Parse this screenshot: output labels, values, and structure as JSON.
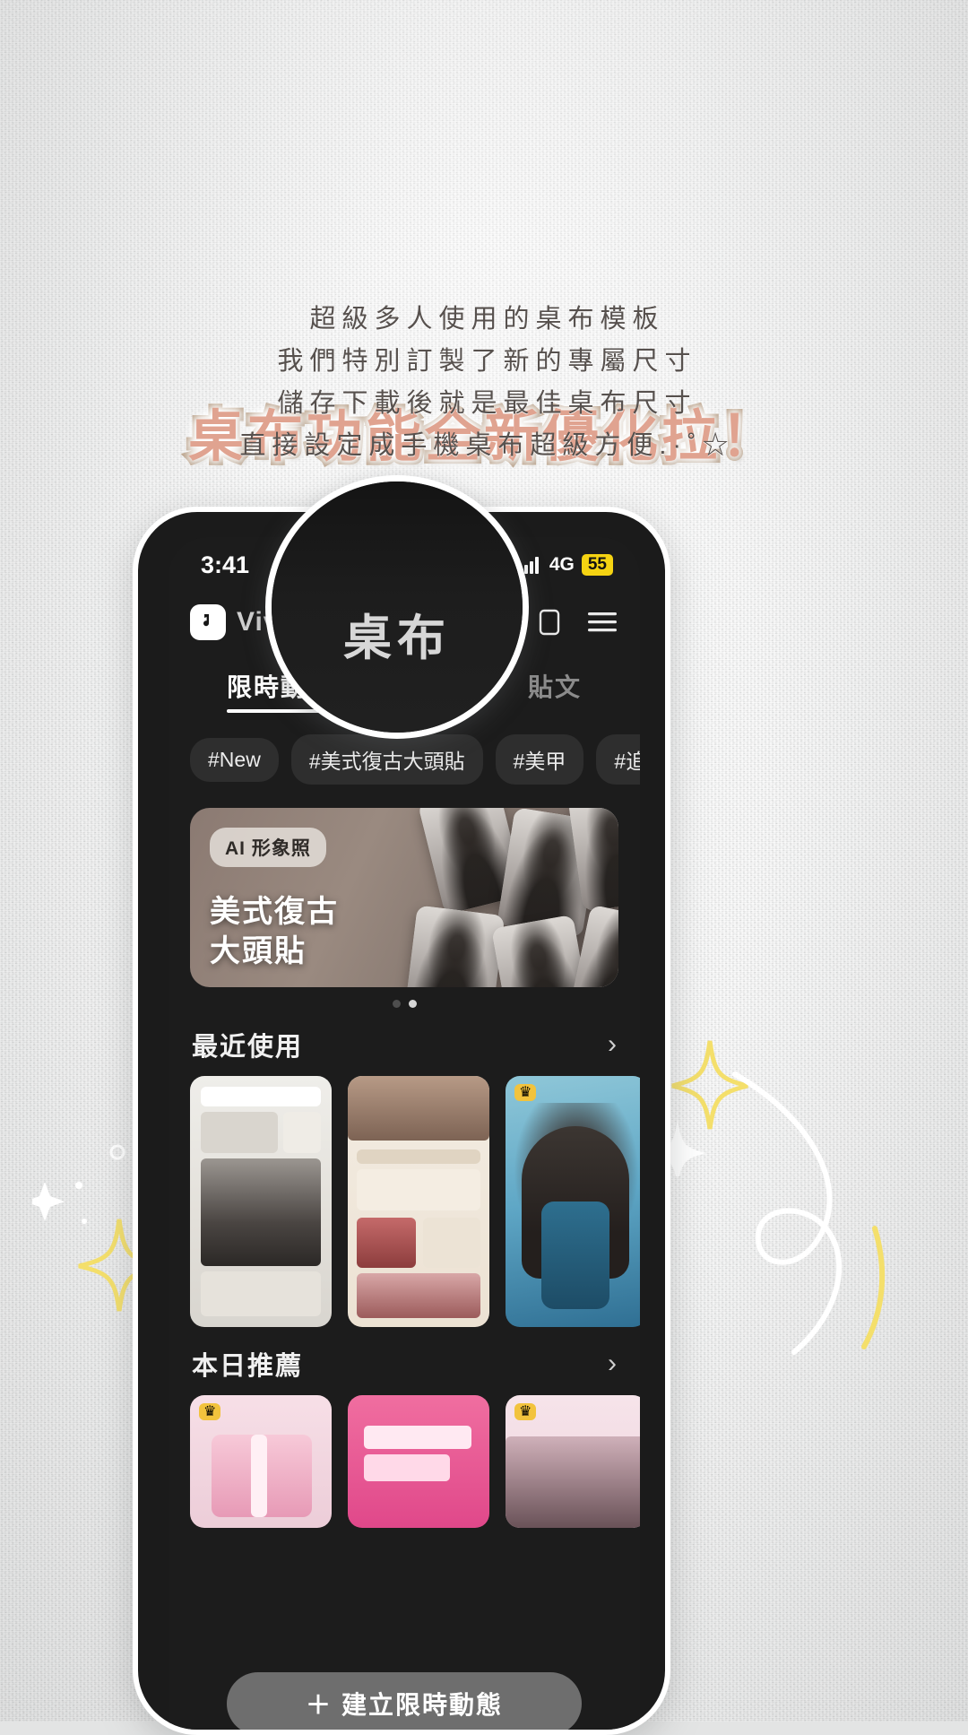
{
  "page": {
    "headline": "桌布功能全新優化拉！",
    "subtitle_lines": [
      "超級多人使用的桌布模板",
      "我們特別訂製了新的專屬尺寸",
      "儲存下載後就是最佳桌布尺寸",
      "直接設定成手機桌布超級方便.·˚☆"
    ],
    "headline_fill_color": "#e2a592",
    "headline_stroke_color": "#b9a189",
    "background_color": "#e5e6e6"
  },
  "magnifier": {
    "label": "桌布"
  },
  "phone": {
    "status_bar": {
      "time": "3:41",
      "network": "4G",
      "battery": "55",
      "signal_icon": "signal-bars-icon",
      "battery_color": "#f5d312"
    },
    "header": {
      "logo_icon": "app-logo-icon",
      "brand": "Vivi",
      "icons": [
        "grid-icon",
        "tablet-icon",
        "hamburger-menu-icon"
      ]
    },
    "tabs": [
      {
        "label": "限時動態",
        "active": true
      },
      {
        "label": "桌布",
        "active": false
      },
      {
        "label": "貼文",
        "active": false
      }
    ],
    "chips": [
      "#New",
      "#美式復古大頭貼",
      "#美甲",
      "#追星"
    ],
    "chip_search_icon": "search-icon",
    "banner": {
      "badge": "AI 形象照",
      "title_line1": "美式復古",
      "title_line2": "大頭貼",
      "dots_total": 2,
      "dot_active_index": 1
    },
    "sections": [
      {
        "title": "最近使用",
        "chevron": "›",
        "cards": [
          {
            "name": "portfolio-template",
            "crown": false
          },
          {
            "name": "dessert-template",
            "crown": false
          },
          {
            "name": "bon-voyage-template",
            "crown": true
          },
          {
            "name": "blank-template",
            "crown": false
          }
        ]
      },
      {
        "title": "本日推薦",
        "chevron": "›",
        "cards": [
          {
            "name": "pink-gift-template",
            "crown": true
          },
          {
            "name": "in-my-life-template",
            "crown": false
          },
          {
            "name": "pink-portrait-template",
            "crown": true
          },
          {
            "name": "white-template",
            "crown": false
          }
        ]
      }
    ],
    "fab": {
      "label": "建立限時動態",
      "icon": "plus-icon"
    }
  }
}
